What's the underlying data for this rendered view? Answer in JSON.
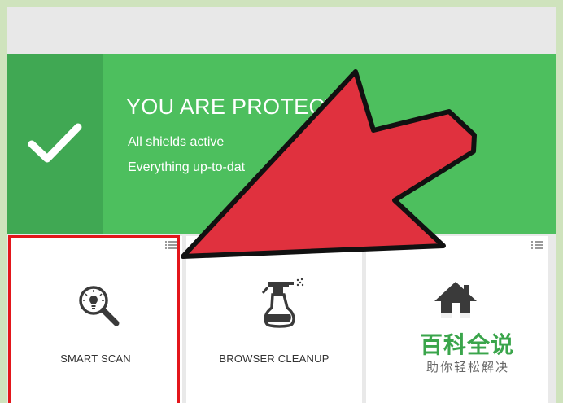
{
  "status": {
    "title": "YOU ARE PROTECT",
    "line1": "All shields active",
    "line2": "Everything up-to-dat"
  },
  "tiles": [
    {
      "label": "SMART SCAN",
      "icon": "smart-scan-icon"
    },
    {
      "label": "BROWSER CLEANUP",
      "icon": "spray-bottle-icon"
    },
    {
      "label": "",
      "icon": "home-network-icon"
    }
  ],
  "watermark": {
    "title": "百科全说",
    "subtitle": "助你轻松解决"
  },
  "colors": {
    "status_green": "#4dbf5e",
    "status_green_dark": "#40a853",
    "arrow_red": "#e0313e",
    "highlight_red": "#e3161b"
  }
}
